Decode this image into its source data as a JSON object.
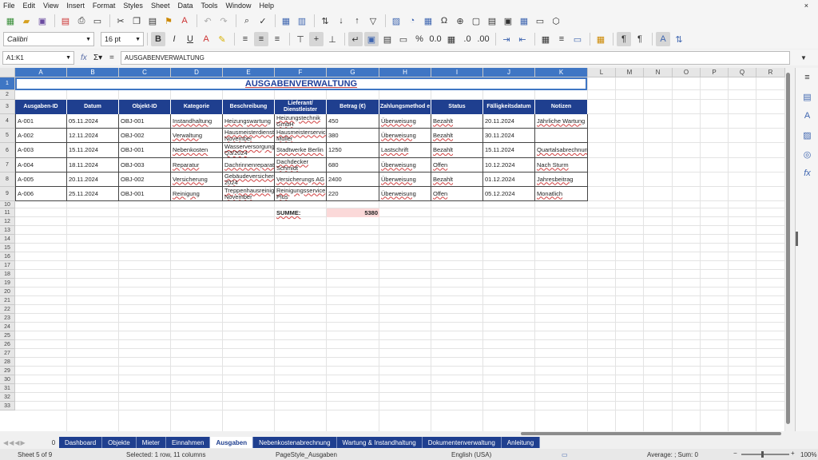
{
  "menu": [
    "File",
    "Edit",
    "View",
    "Insert",
    "Format",
    "Styles",
    "Sheet",
    "Data",
    "Tools",
    "Window",
    "Help"
  ],
  "window_close": "×",
  "font_name": "Calibri",
  "font_size": "16 pt",
  "name_box": "A1:K1",
  "formula": "AUSGABENVERWALTUNG",
  "columns": [
    "A",
    "B",
    "C",
    "D",
    "E",
    "F",
    "G",
    "H",
    "I",
    "J",
    "K",
    "L",
    "M",
    "N",
    "O",
    "P",
    "Q",
    "R"
  ],
  "rows": [
    "1",
    "2",
    "3",
    "4",
    "5",
    "6",
    "7",
    "8",
    "9",
    "10",
    "11",
    "12",
    "13",
    "14",
    "15",
    "16",
    "17",
    "18",
    "19",
    "20",
    "21",
    "22",
    "23",
    "24",
    "25",
    "26",
    "27",
    "28",
    "29",
    "30",
    "31",
    "32",
    "33"
  ],
  "sheet_title": "AUSGABENVERWALTUNG",
  "headers": [
    "Ausgaben-ID",
    "Datum",
    "Objekt-ID",
    "Kategorie",
    "Beschreibung",
    "Lieferant/ Dienstleister",
    "Betrag (€)",
    "Zahlungsmethod e",
    "Status",
    "Fälligkeitsdatum",
    "Notizen"
  ],
  "table_rows": [
    [
      "A-001",
      "05.11.2024",
      "OBJ-001",
      "Instandhaltung",
      "Heizungswartung",
      "Heizungstechnik GmbH",
      "450",
      "Überweisung",
      "Bezahlt",
      "20.11.2024",
      "Jährliche Wartung"
    ],
    [
      "A-002",
      "12.11.2024",
      "OBJ-002",
      "Verwaltung",
      "Hausmeisterdienst November",
      "Hausmeisterservice Müller",
      "380",
      "Überweisung",
      "Bezahlt",
      "30.11.2024",
      ""
    ],
    [
      "A-003",
      "15.11.2024",
      "OBJ-001",
      "Nebenkosten",
      "Wasserversorgung Q3/2024",
      "Stadtwerke Berlin",
      "1250",
      "Lastschrift",
      "Bezahlt",
      "15.11.2024",
      "Quartalsabrechnung"
    ],
    [
      "A-004",
      "18.11.2024",
      "OBJ-003",
      "Reparatur",
      "Dachrinnenreparatur",
      "Dachdecker Schmidt",
      "680",
      "Überweisung",
      "Offen",
      "10.12.2024",
      "Nach Sturm"
    ],
    [
      "A-005",
      "20.11.2024",
      "OBJ-002",
      "Versicherung",
      "Gebäudeversicherung 2024",
      "Versicherungs AG",
      "2400",
      "Überweisung",
      "Bezahlt",
      "01.12.2024",
      "Jahresbeitrag"
    ],
    [
      "A-006",
      "25.11.2024",
      "OBJ-001",
      "Reinigung",
      "Treppenhausreinigung November",
      "Reinigungsservice Plus",
      "220",
      "Überweisung",
      "Offen",
      "05.12.2024",
      "Monatlich"
    ]
  ],
  "sum_label": "SUMME:",
  "sum_value": "5380",
  "tabs": [
    "Dashboard",
    "Objekte",
    "Mieter",
    "Einnahmen",
    "Ausgaben",
    "Nebenkostenabrechnung",
    "Wartung & Instandhaltung",
    "Dokumentenverwaltung",
    "Anleitung"
  ],
  "active_tab": "Ausgaben",
  "tab_add": "0",
  "status": {
    "sheet": "Sheet 5 of 9",
    "selection": "Selected: 1 row, 11 columns",
    "page_style": "PageStyle_Ausgaben",
    "language": "English (USA)",
    "stats": "Average: ; Sum: 0",
    "zoom": "100%"
  },
  "colors": {
    "header_bg": "#1f3f8f",
    "selection": "#3f76c4",
    "sum_bg": "#fbd9d9"
  }
}
